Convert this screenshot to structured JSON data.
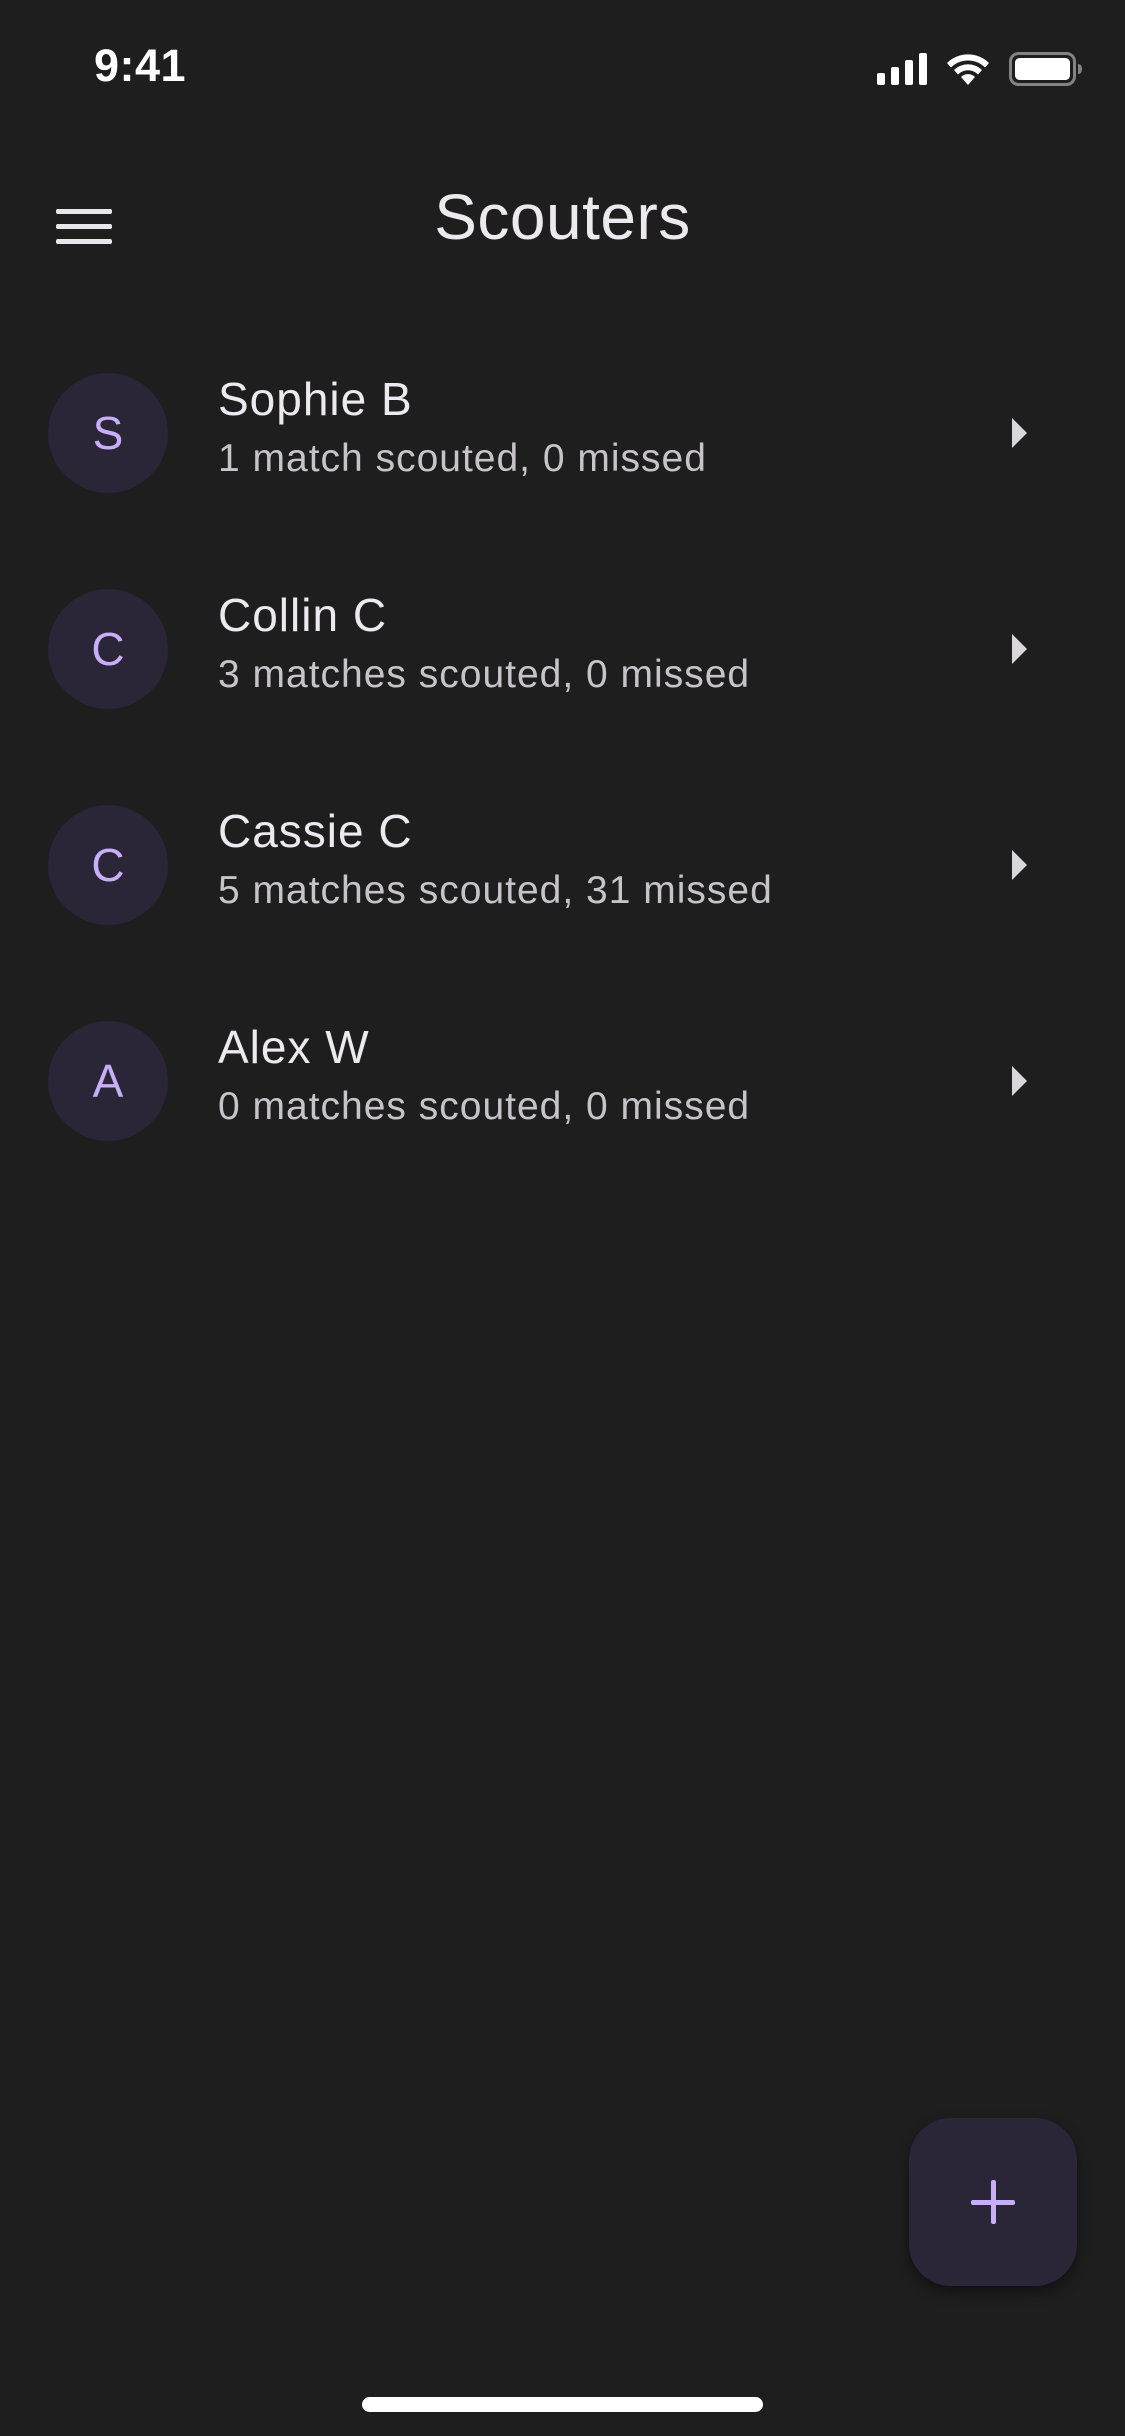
{
  "status_bar": {
    "time": "9:41"
  },
  "app_bar": {
    "title": "Scouters",
    "menu_icon": "hamburger-menu-icon"
  },
  "scouters": [
    {
      "initial": "S",
      "name": "Sophie B",
      "subtitle": "1 match scouted, 0 missed"
    },
    {
      "initial": "C",
      "name": "Collin C",
      "subtitle": "3 matches scouted, 0 missed"
    },
    {
      "initial": "C",
      "name": "Cassie C",
      "subtitle": "5 matches scouted, 31 missed"
    },
    {
      "initial": "A",
      "name": "Alex W",
      "subtitle": "0 matches scouted, 0 missed"
    }
  ],
  "fab": {
    "icon": "plus-icon"
  },
  "colors": {
    "background": "#1e1e1f",
    "avatar_bg": "#2b2538",
    "accent": "#c8aef7",
    "text_primary": "#ece9ef",
    "text_secondary": "#c6c3c9"
  }
}
